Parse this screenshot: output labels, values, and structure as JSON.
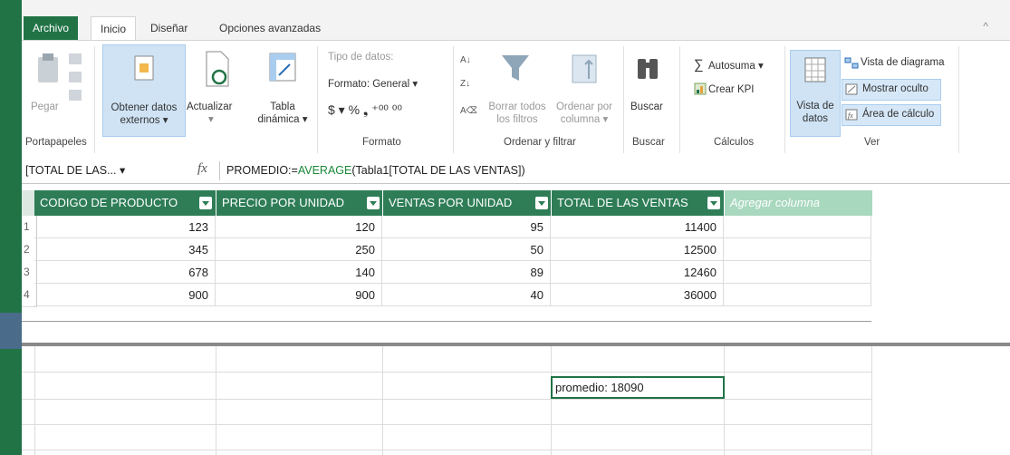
{
  "tabs": [
    {
      "label": "Archivo"
    },
    {
      "label": "Inicio"
    },
    {
      "label": "Diseñar"
    },
    {
      "label": "Opciones avanzadas"
    }
  ],
  "ribbon": {
    "portapapeles": {
      "pegar": "Pegar",
      "label": "Portapapeles"
    },
    "obtener": {
      "line1": "Obtener datos",
      "line2": "externos ▾"
    },
    "actualizar": {
      "label": "Actualizar"
    },
    "tabla": {
      "line1": "Tabla",
      "line2": "dinámica ▾"
    },
    "formato": {
      "tipo": "Tipo de datos:",
      "formato": "Formato: General ▾",
      "symbols": "$ ▾  %  ❟  ⁺⁰⁰  ⁰⁰",
      "label": "Formato"
    },
    "ordenar": {
      "borrar1": "Borrar todos",
      "borrar2": "los filtros",
      "ordenar1": "Ordenar por",
      "ordenar2": "columna ▾",
      "label": "Ordenar y filtrar"
    },
    "buscar": {
      "btn": "Buscar",
      "label": "Buscar"
    },
    "calculos": {
      "autosuma": "Autosuma ▾",
      "kpi": "Crear KPI",
      "label": "Cálculos"
    },
    "ver": {
      "vista1": "Vista de",
      "vista2": "datos",
      "diagrama": "Vista de diagrama",
      "oculto": "Mostrar oculto",
      "area": "Área de cálculo",
      "label": "Ver"
    }
  },
  "formula_bar": {
    "name_box": "[TOTAL DE LAS... ▾",
    "fx": "fx",
    "prefix": "PROMEDIO:=",
    "function": "AVERAGE",
    "args": "(Tabla1[TOTAL DE LAS VENTAS])"
  },
  "table": {
    "columns": [
      "CODIGO DE PRODUCTO",
      "PRECIO POR UNIDAD",
      "VENTAS POR UNIDAD",
      "TOTAL DE LAS VENTAS"
    ],
    "add_column": "Agregar columna",
    "rows": [
      {
        "n": "1",
        "cells": [
          "123",
          "120",
          "95",
          "11400"
        ]
      },
      {
        "n": "2",
        "cells": [
          "345",
          "250",
          "50",
          "12500"
        ]
      },
      {
        "n": "3",
        "cells": [
          "678",
          "140",
          "89",
          "12460"
        ]
      },
      {
        "n": "4",
        "cells": [
          "900",
          "900",
          "40",
          "36000"
        ]
      }
    ]
  },
  "calc_area": {
    "measure": "promedio: 18090"
  },
  "colors": {
    "accent": "#217346",
    "header": "#2e7d57",
    "add_column": "#a8d8be"
  }
}
